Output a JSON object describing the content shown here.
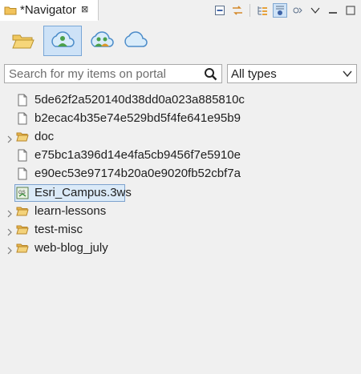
{
  "tab": {
    "title": "*Navigator",
    "close_symbol": "⊠"
  },
  "sources": [
    {
      "name": "folder-source"
    },
    {
      "name": "portal-user-source"
    },
    {
      "name": "portal-group-source"
    },
    {
      "name": "cloud-source"
    }
  ],
  "search": {
    "placeholder": "Search for my items on portal",
    "value": ""
  },
  "filter": {
    "selected": "All types"
  },
  "tree": [
    {
      "label": "5de62f2a520140d38dd0a023a885810c",
      "type": "file",
      "expandable": false
    },
    {
      "label": "b2ecac4b35e74e529bd5f4fe641e95b9",
      "type": "file",
      "expandable": false
    },
    {
      "label": "doc",
      "type": "folder",
      "expandable": true
    },
    {
      "label": "e75bc1a396d14e4fa5cb9456f7e5910e",
      "type": "file",
      "expandable": false
    },
    {
      "label": "e90ec53e97174b20a0e9020fb52cbf7a",
      "type": "file",
      "expandable": false
    },
    {
      "label": "Esri_Campus.3ws",
      "type": "scene",
      "expandable": false,
      "selected": true
    },
    {
      "label": "learn-lessons",
      "type": "folder",
      "expandable": true
    },
    {
      "label": "test-misc",
      "type": "folder",
      "expandable": true
    },
    {
      "label": "web-blog_july",
      "type": "folder",
      "expandable": true
    }
  ],
  "colors": {
    "accent": "#78a6d6",
    "selection": "#dbeaf8",
    "folder": "#e8b64c"
  }
}
